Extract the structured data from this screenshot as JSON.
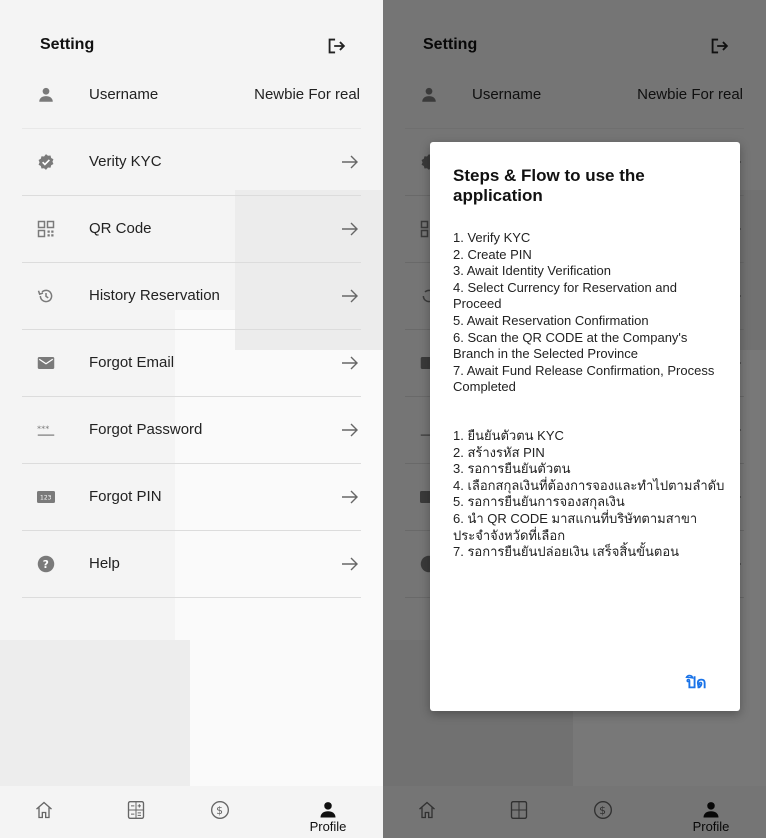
{
  "header": {
    "title": "Setting",
    "logout_icon": "logout-icon"
  },
  "settings": {
    "items": [
      {
        "label": "Username",
        "value": "Newbie For real",
        "icon": "person-icon"
      },
      {
        "label": "Verity KYC",
        "icon": "verified-badge-icon"
      },
      {
        "label": "QR Code",
        "icon": "qr-code-icon"
      },
      {
        "label": "History Reservation",
        "icon": "history-icon"
      },
      {
        "label": "Forgot Email",
        "icon": "mail-icon"
      },
      {
        "label": "Forgot Password",
        "icon": "password-dots-icon"
      },
      {
        "label": "Forgot PIN",
        "icon": "pin-123-icon"
      },
      {
        "label": "Help",
        "icon": "help-icon"
      }
    ]
  },
  "nav": {
    "items": [
      {
        "label": "",
        "icon": "home-icon"
      },
      {
        "label": "",
        "icon": "calculator-icon"
      },
      {
        "label": "",
        "icon": "dollar-coin-icon"
      },
      {
        "label": "Profile",
        "icon": "person-icon",
        "active": true
      }
    ]
  },
  "dialog": {
    "title": "Steps & Flow to use the application",
    "steps_en": [
      "1. Verify KYC",
      "2. Create PIN",
      "3. Await Identity Verification",
      "4. Select Currency for Reservation and Proceed",
      "5. Await Reservation Confirmation",
      "6. Scan the QR CODE at the Company's Branch in the Selected Province",
      "7. Await Fund Release Confirmation, Process Completed"
    ],
    "steps_th": [
      "1. ยืนยันตัวตน KYC",
      "2. สร้างรหัส PIN",
      "3. รอการยืนยันตัวตน",
      "4. เลือกสกุลเงินที่ต้องการจองและทำไปตามลำดับ",
      "5. รอการยืนยันการจองสกุลเงิน",
      "6. นำ QR CODE มาสแกนที่บริษัทตามสาขาประจำจังหวัดที่เลือก",
      "7. รอการยืนยันปล่อยเงิน เสร็จสิ้นขั้นตอน"
    ],
    "close_label": "ปิด"
  },
  "colors": {
    "accent": "#1a73e8",
    "icon": "#7a7a7a",
    "overlay": "#000000"
  }
}
